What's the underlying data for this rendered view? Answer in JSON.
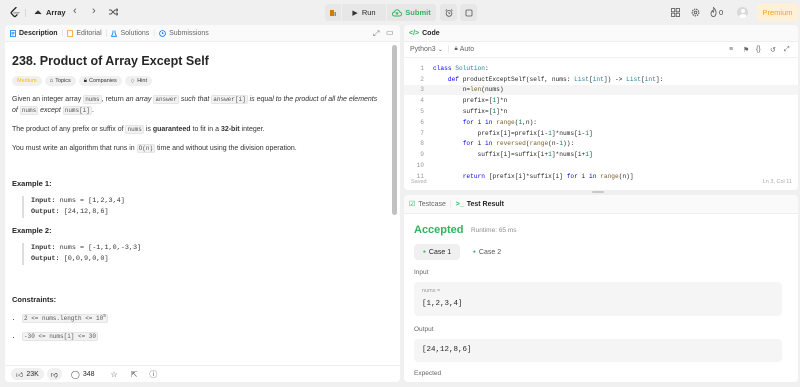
{
  "top": {
    "title": "Array",
    "run": "Run",
    "submit": "Submit",
    "streak": "0",
    "premium": "Premium"
  },
  "left_tabs": [
    "Description",
    "Editorial",
    "Solutions",
    "Submissions"
  ],
  "problem": {
    "title": "238. Product of Array Except Self",
    "difficulty": "Medium",
    "pills": [
      "Topics",
      "Companies",
      "Hint"
    ],
    "p1": [
      "Given an integer array ",
      "nums",
      ", return ",
      "an array ",
      "answer",
      " such that ",
      "answer[i]",
      " is equal to the product of all the elements of ",
      "nums",
      " except ",
      "nums[i]",
      "."
    ],
    "p2": [
      "The product of any prefix or suffix of ",
      "nums",
      " is ",
      "guaranteed",
      " to fit in a ",
      "32-bit",
      " integer."
    ],
    "p3": [
      "You must write an algorithm that runs in ",
      "O(n)",
      " time and without using the division operation."
    ],
    "examples": [
      {
        "title": "Example 1:",
        "input_label": "Input:",
        "input": "nums = [1,2,3,4]",
        "output_label": "Output:",
        "output": "[24,12,8,6]"
      },
      {
        "title": "Example 2:",
        "input_label": "Input:",
        "input": "nums = [-1,1,0,-3,3]",
        "output_label": "Output:",
        "output": "[0,0,9,0,0]"
      }
    ],
    "constraints_title": "Constraints:",
    "constraints": [
      "2 <= nums.length <= 10",
      "-30 <= nums[i] <= 30"
    ],
    "constraint_sup": "5"
  },
  "footer": {
    "likes": "23K",
    "comments": "348"
  },
  "code": {
    "tab": "Code",
    "language": "Python3",
    "mode": "Auto",
    "lines": [
      "class Solution:",
      "    def productExceptSelf(self, nums: List[int]) -> List[int]:",
      "        n=len(nums)",
      "        prefix=[1]*n",
      "        suffix=[1]*n",
      "        for i in range(1,n):",
      "            prefix[i]=prefix[i-1]*nums[i-1]",
      "        for i in reversed(range(n-1)):",
      "            suffix[i]=suffix[i+1]*nums[i+1]",
      "",
      "        return [prefix[i]*suffix[i] for i in range(n)]"
    ],
    "saved": "Saved",
    "cursor": "Ln 3, Col 11"
  },
  "result": {
    "tabs": [
      "Testcase",
      "Test Result"
    ],
    "status": "Accepted",
    "runtime": "Runtime: 65 ms",
    "cases": [
      "Case 1",
      "Case 2"
    ],
    "input_label": "Input",
    "var_label": "nums =",
    "input_value": "[1,2,3,4]",
    "output_label": "Output",
    "output_value": "[24,12,8,6]",
    "expected_label": "Expected"
  },
  "colors": {
    "accent": "#2db55d",
    "medium": "#ffb800",
    "orange": "#ffa116",
    "blue": "#007aff"
  }
}
